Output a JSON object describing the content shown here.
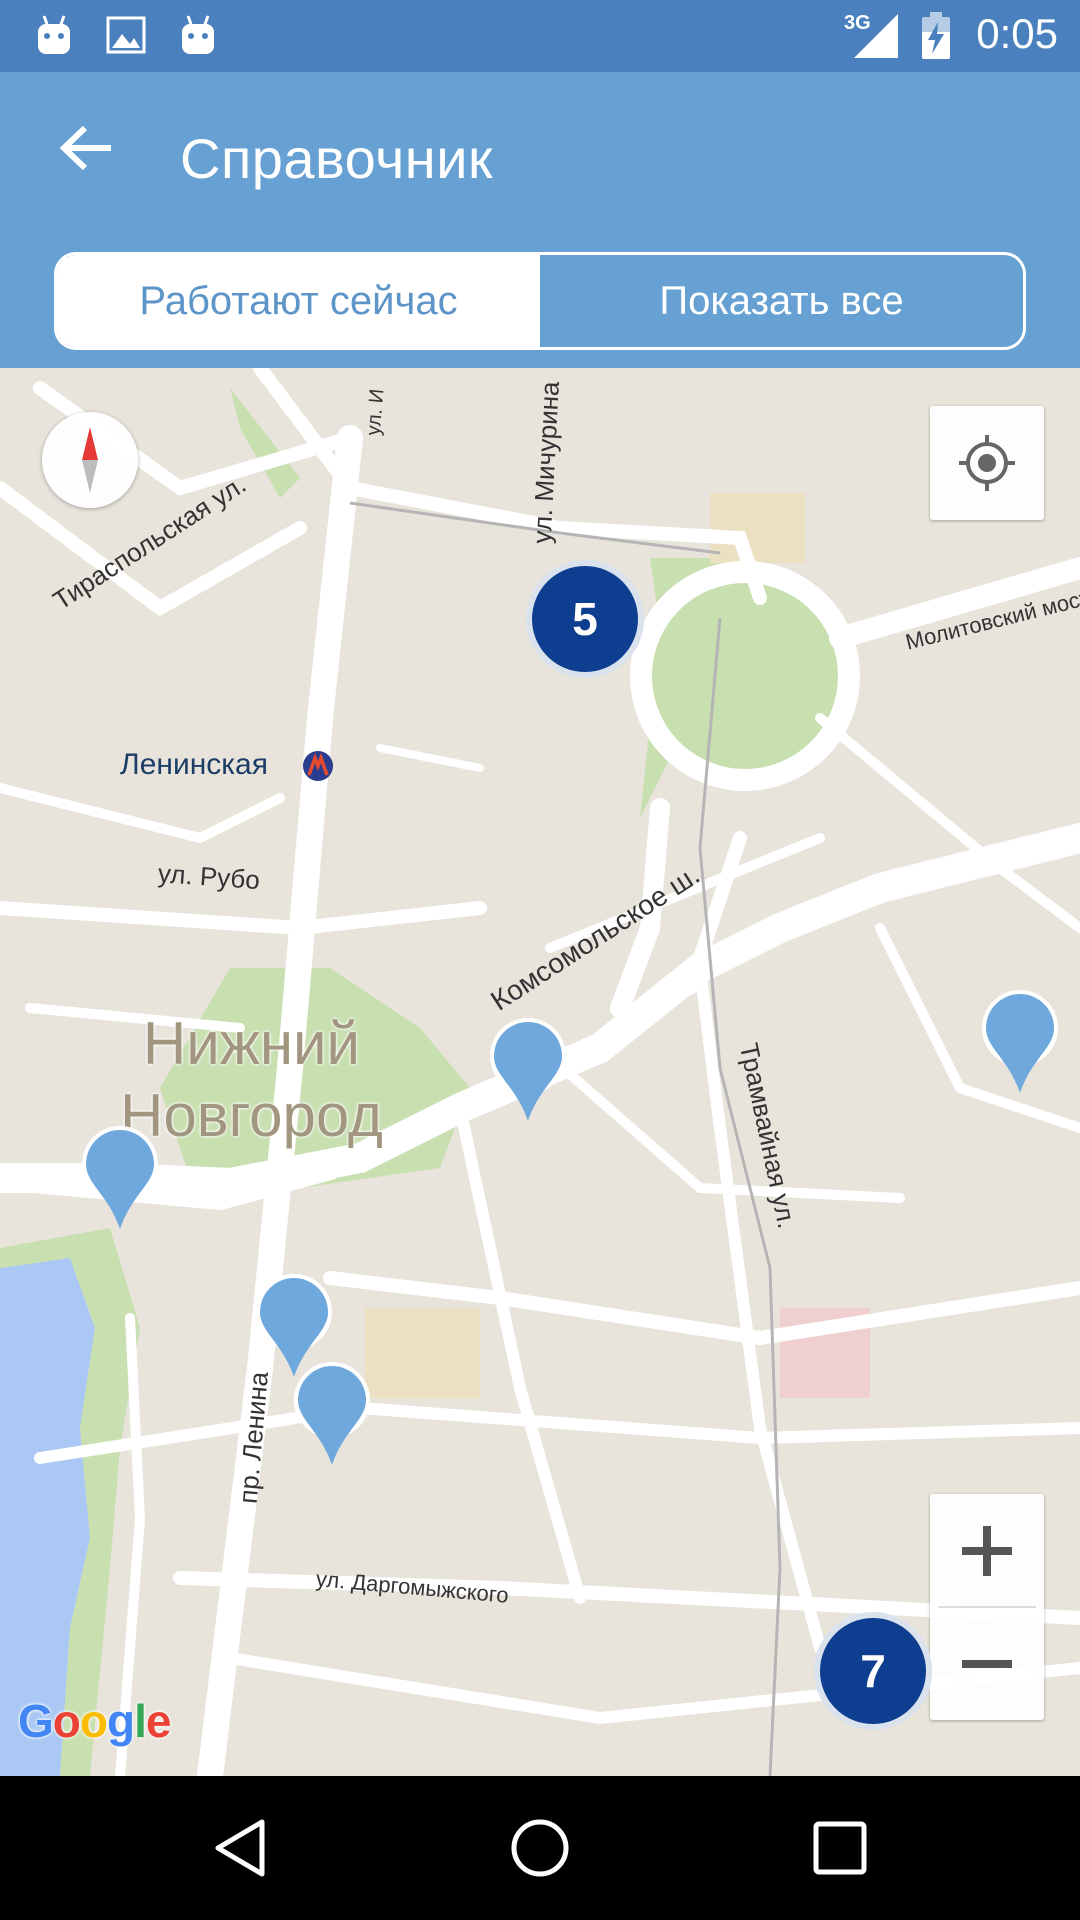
{
  "status_bar": {
    "time": "0:05",
    "network": "3G",
    "icons": [
      "android-icon",
      "image-icon",
      "android-icon",
      "signal-icon",
      "battery-charging-icon"
    ]
  },
  "app_bar": {
    "title": "Справочник",
    "back_icon": "arrow-back-icon"
  },
  "filter": {
    "options": [
      "Работают сейчас",
      "Показать все"
    ],
    "selected": "Работают сейчас"
  },
  "map": {
    "city_label": [
      "Нижний",
      "Новгород"
    ],
    "metro_station": "Ленинская",
    "streets": [
      "Тираспольская ул.",
      "ул. Мичурина",
      "Молитовский мост",
      "ул. Рубо",
      "Комсомольское ш.",
      "Трамвайная ул.",
      "пр. Ленина",
      "ул. Даргомыжского",
      "ул. И"
    ],
    "clusters": [
      {
        "count": "5"
      },
      {
        "count": "7"
      }
    ],
    "pins_count": 5,
    "controls": {
      "compass_icon": "compass-icon",
      "my_location_icon": "my-location-icon",
      "zoom_in": "+",
      "zoom_out": "−"
    },
    "attribution": "Google",
    "colors": {
      "cluster": "#0d3e8f",
      "pin": "#6fa8dc",
      "park": "#c8dfb0",
      "water": "#abc8f5"
    }
  },
  "nav_bar": {
    "icons": [
      "back-triangle-icon",
      "home-circle-icon",
      "recents-square-icon"
    ]
  }
}
